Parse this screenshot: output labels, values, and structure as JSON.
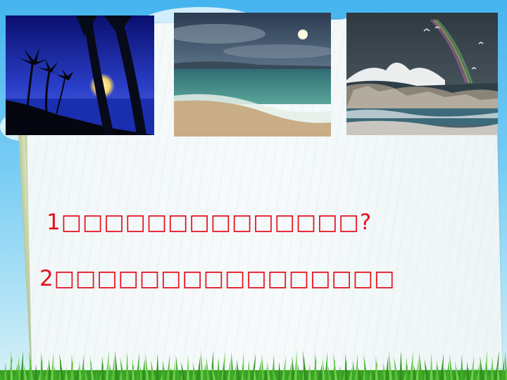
{
  "photos": [
    {
      "name": "moonlit-palm-night",
      "colors": {
        "sky": "#1c2aa8",
        "moon": "#fff2a8"
      }
    },
    {
      "name": "moonlit-beach",
      "colors": {
        "sky": "#3b4c60",
        "sea": "#3d8a7e",
        "sand": "#c9b08a"
      }
    },
    {
      "name": "waves-on-rocks",
      "colors": {
        "sky": "#3c4850",
        "spray": "#ffffff"
      }
    }
  ],
  "questions": [
    {
      "number": "1",
      "text": "□□□□□□□□□□□□□□?"
    },
    {
      "number": "2",
      "text": "□□□□□□□□□□□□□□□□"
    }
  ],
  "theme": {
    "question_color": "#e8101e",
    "sky_top": "#45b4ee",
    "grass": "#3fae2a"
  }
}
